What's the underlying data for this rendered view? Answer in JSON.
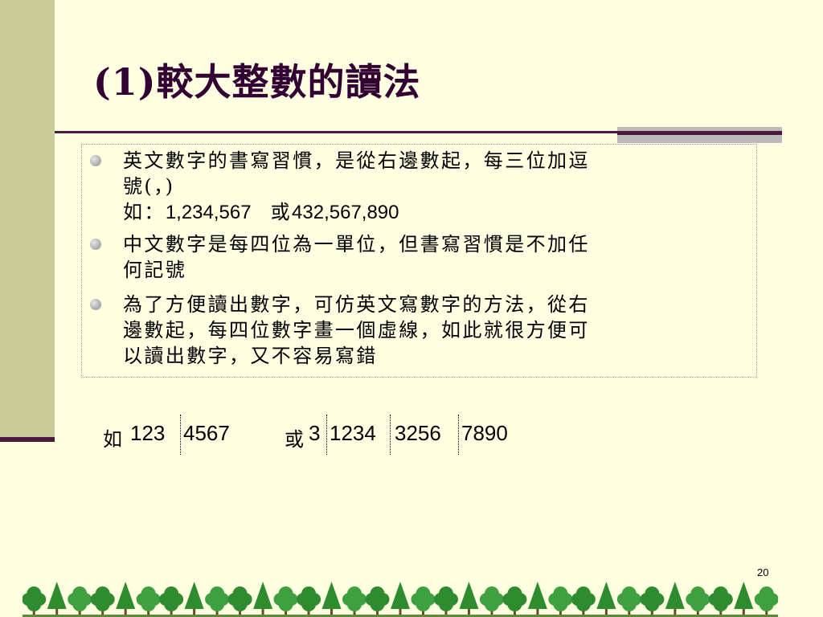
{
  "slide": {
    "title": "(1)較大整數的讀法",
    "page_number": "20"
  },
  "bullets": [
    {
      "line1": "英文數字的書寫習慣，是從右邊數起，每三位加逗",
      "line2": "號(，)",
      "line3_prefix": "如：",
      "line3_num1": "1,234,567",
      "line3_or": "或",
      "line3_num2": "432,567,890"
    },
    {
      "line1": "中文數字是每四位為一單位，但書寫習慣是不加任",
      "line2": "何記號"
    },
    {
      "line1": "為了方便讀出數字，可仿英文寫數字的方法，從右",
      "line2": "邊數起，每四位數字畫一個虛線，如此就很方便可",
      "line3": "以讀出數字，又不容易寫錯"
    }
  ],
  "example": {
    "prefix_1": "如",
    "group_1a": "123",
    "group_1b": "4567",
    "prefix_2": "或",
    "group_2a": "3",
    "group_2b": "1234",
    "group_2c": "3256",
    "group_2d": "7890"
  },
  "colors": {
    "background": "#FFFFE1",
    "side_band": "#CCCC99",
    "accent_line": "#4B1840",
    "title": "#330033",
    "tree_green": "#2E8B2E"
  }
}
